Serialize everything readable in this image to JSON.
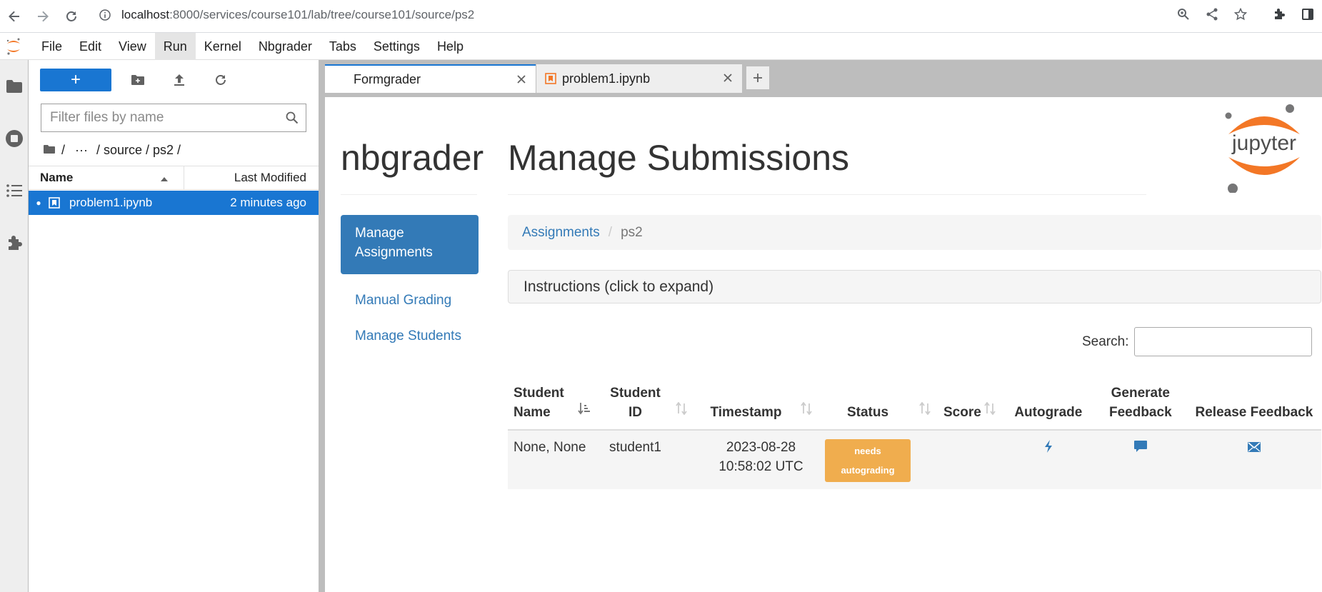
{
  "browser": {
    "url_host": "localhost",
    "url_rest": ":8000/services/course101/lab/tree/course101/source/ps2"
  },
  "menu": {
    "items": [
      {
        "label": "File"
      },
      {
        "label": "Edit"
      },
      {
        "label": "View"
      },
      {
        "label": "Run",
        "active": true
      },
      {
        "label": "Kernel"
      },
      {
        "label": "Nbgrader"
      },
      {
        "label": "Tabs"
      },
      {
        "label": "Settings"
      },
      {
        "label": "Help"
      }
    ]
  },
  "filebrowser": {
    "new_label": "+",
    "filter_placeholder": "Filter files by name",
    "crumbs": {
      "root": "/",
      "ellipsis": "···",
      "path": "/ source / ps2 /"
    },
    "col_name": "Name",
    "col_modified": "Last Modified",
    "files": [
      {
        "name": "problem1.ipynb",
        "modified": "2 minutes ago"
      }
    ]
  },
  "tabs": [
    {
      "label": "Formgrader",
      "active": true
    },
    {
      "label": "problem1.ipynb",
      "active": false
    }
  ],
  "formgrader": {
    "brand": "nbgrader",
    "title": "Manage Submissions",
    "logo_text": "jupyter",
    "nav": {
      "manage_assignments": "Manage Assignments",
      "manual_grading": "Manual Grading",
      "manage_students": "Manage Students"
    },
    "breadcrumb": {
      "assignments": "Assignments",
      "sep": "/",
      "current": "ps2"
    },
    "instructions": "Instructions (click to expand)",
    "search_label": "Search:",
    "table": {
      "headers": {
        "student_name": "Student Name",
        "student_id": "Student ID",
        "timestamp": "Timestamp",
        "status": "Status",
        "score": "Score",
        "autograde": "Autograde",
        "generate_feedback": "Generate Feedback",
        "release_feedback": "Release Feedback"
      },
      "rows": [
        {
          "student_name": "None, None",
          "student_id": "student1",
          "timestamp": "2023-08-28 10:58:02 UTC",
          "status": "needs autograding",
          "score": ""
        }
      ]
    }
  },
  "colors": {
    "jupyter_orange": "#f37726",
    "accent_blue": "#1976d2",
    "link_blue": "#337ab7",
    "warning": "#f0ad4e"
  }
}
